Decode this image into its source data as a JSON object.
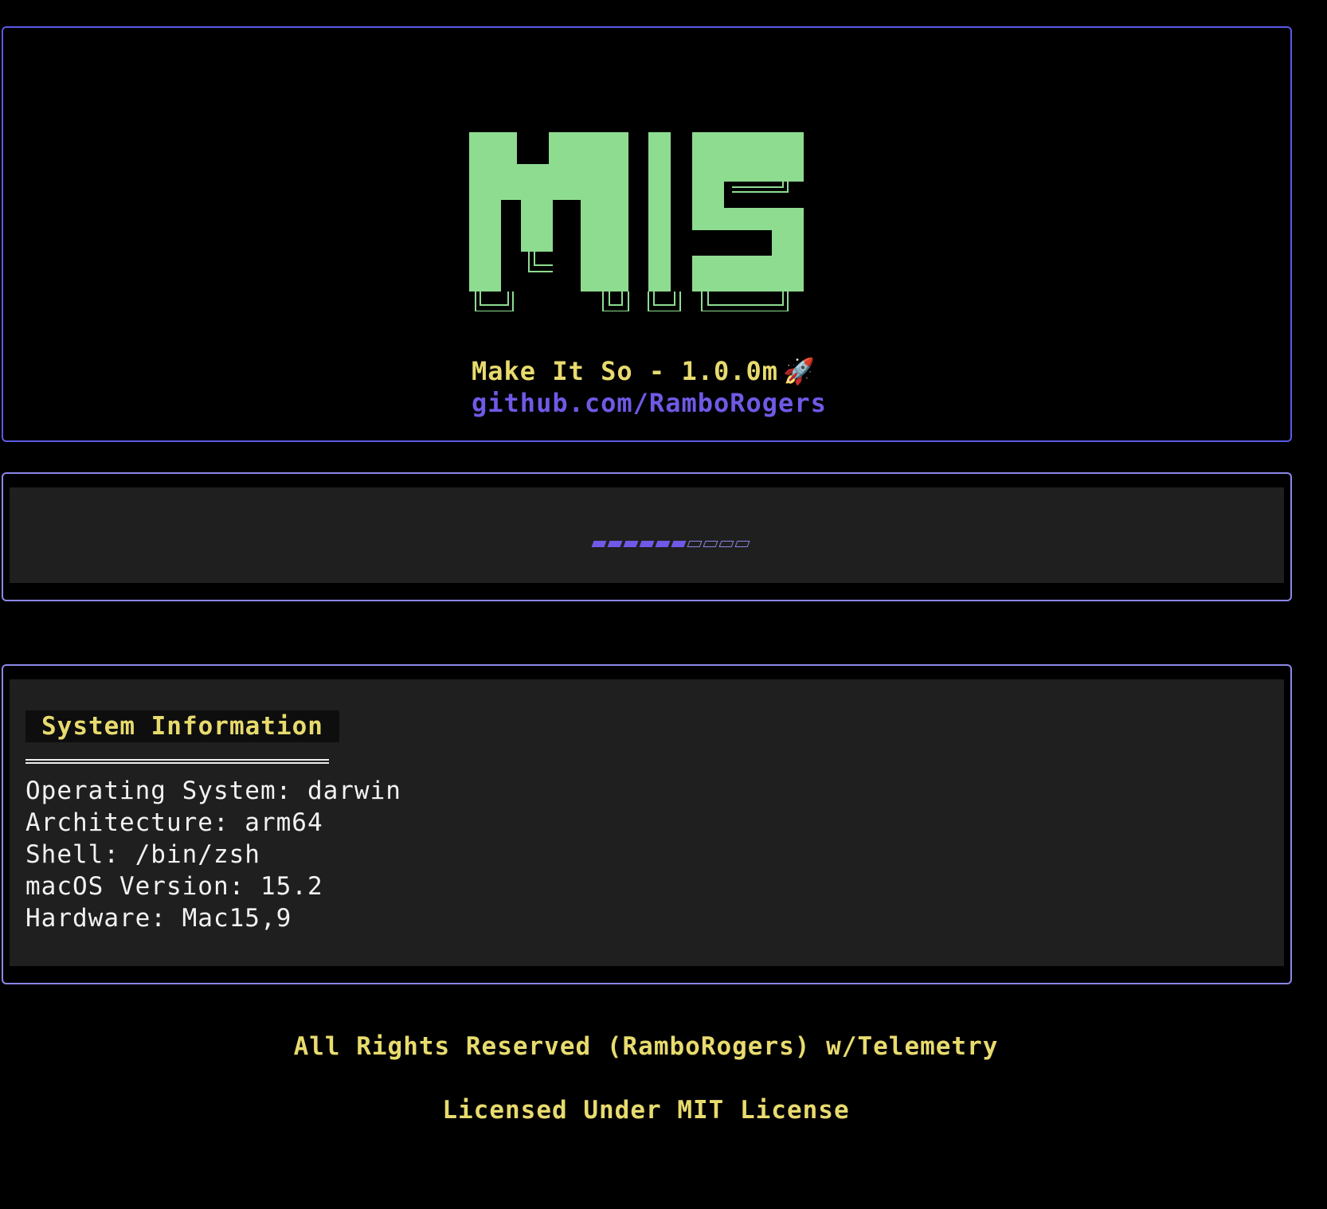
{
  "banner": {
    "logo_text": "MIS",
    "logo_color": "#8edc90",
    "tagline": "Make It So - 1.0.0m",
    "tagline_icon": "rocket-icon",
    "github": "github.com/RamboRogers"
  },
  "progress": {
    "filled_segments": 6,
    "total_segments": 10,
    "fraction": 0.6,
    "accent": "#6e5ae6"
  },
  "system_info": {
    "title": "System Information",
    "lines": [
      "Operating System: darwin",
      "Architecture: arm64",
      "Shell: /bin/zsh",
      "macOS Version: 15.2",
      "Hardware: Mac15,9"
    ]
  },
  "footer": {
    "rights": "All Rights Reserved (RamboRogers) w/Telemetry",
    "license": "Licensed Under MIT License"
  }
}
